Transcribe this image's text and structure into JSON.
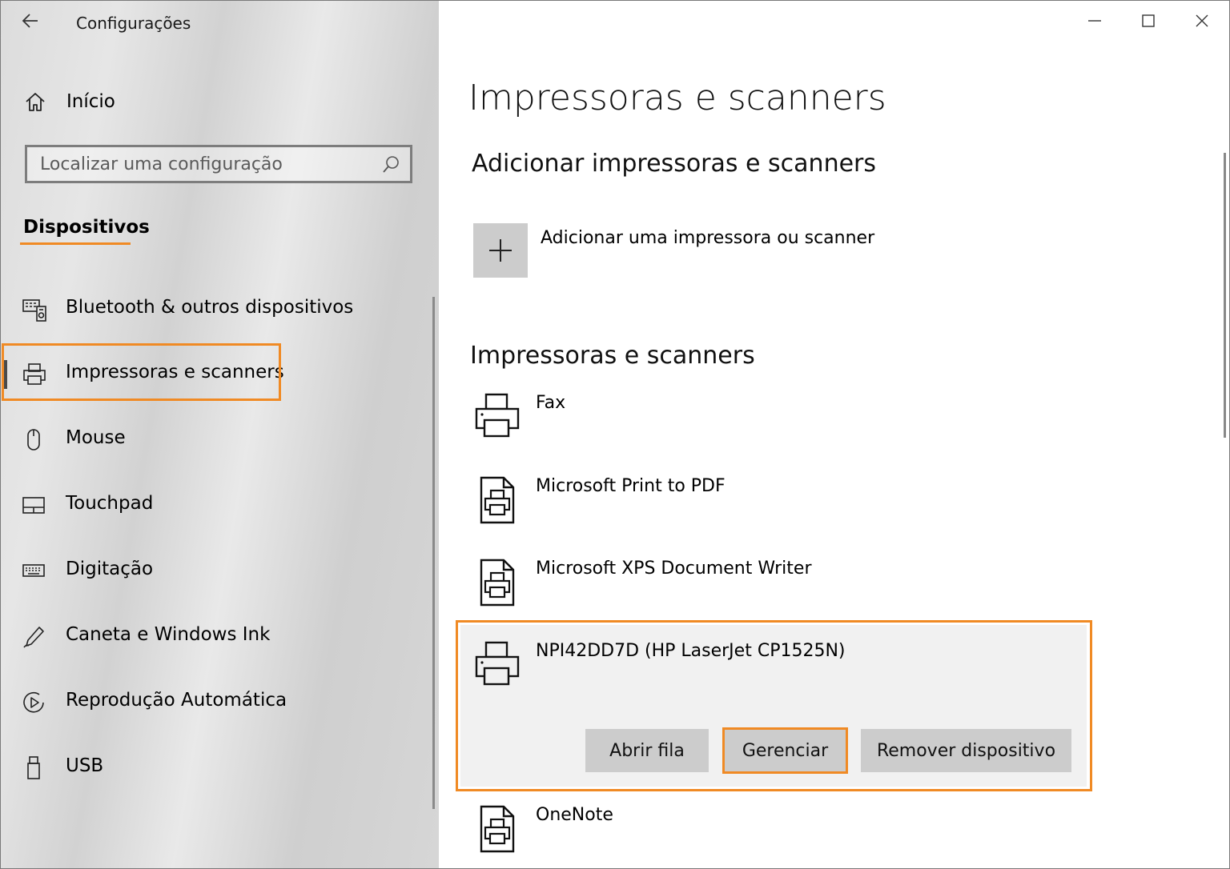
{
  "window": {
    "title": "Configurações",
    "controls": [
      "minimize-icon",
      "maximize-icon",
      "close-icon"
    ]
  },
  "sidebar": {
    "home_label": "Início",
    "search_placeholder": "Localizar uma configuração",
    "section_title": "Dispositivos",
    "items": [
      {
        "label": "Bluetooth & outros dispositivos",
        "icon": "bluetooth-devices-icon"
      },
      {
        "label": "Impressoras e scanners",
        "icon": "printer-icon",
        "active": true
      },
      {
        "label": "Mouse",
        "icon": "mouse-icon"
      },
      {
        "label": "Touchpad",
        "icon": "touchpad-icon"
      },
      {
        "label": "Digitação",
        "icon": "keyboard-icon"
      },
      {
        "label": "Caneta e Windows Ink",
        "icon": "pen-icon"
      },
      {
        "label": "Reprodução Automática",
        "icon": "autoplay-icon"
      },
      {
        "label": "USB",
        "icon": "usb-icon"
      }
    ]
  },
  "main": {
    "page_title": "Impressoras e scanners",
    "add_section_title": "Adicionar impressoras e scanners",
    "add_label": "Adicionar uma impressora ou scanner",
    "list_title": "Impressoras e scanners",
    "printers": [
      {
        "name": "Fax",
        "icon": "printer-icon"
      },
      {
        "name": "Microsoft Print to PDF",
        "icon": "document-printer-icon"
      },
      {
        "name": "Microsoft XPS Document Writer",
        "icon": "document-printer-icon"
      },
      {
        "name": "NPI42DD7D (HP LaserJet CP1525N)",
        "icon": "printer-icon",
        "selected": true
      },
      {
        "name": "OneNote",
        "icon": "document-printer-icon"
      }
    ],
    "actions": {
      "open_queue": "Abrir fila",
      "manage": "Gerenciar",
      "remove": "Remover dispositivo"
    }
  },
  "colors": {
    "highlight": "#f08a24",
    "button_bg": "#cccccc",
    "selected_bg": "#f1f1f1"
  }
}
